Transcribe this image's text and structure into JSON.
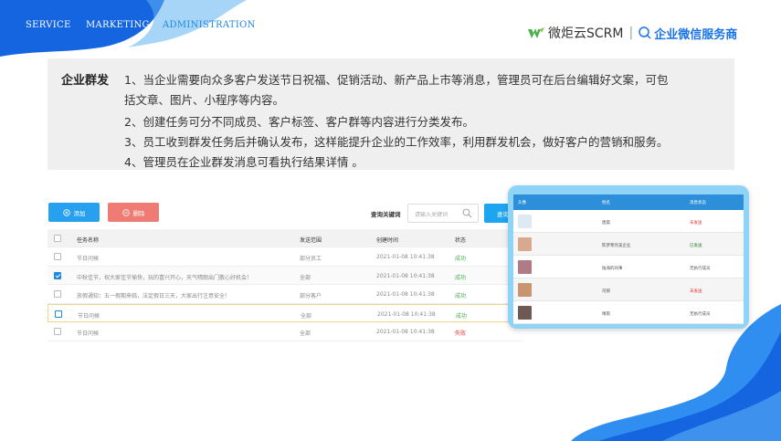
{
  "nav": {
    "items": [
      "SERVICE",
      "MARKETING",
      "ADMINISTRATION"
    ]
  },
  "brand": {
    "product": "微炬云SCRM",
    "separator": "|",
    "tagline": "企业微信服务商",
    "color": "#1a73e8"
  },
  "intro": {
    "title": "企业群发",
    "lines": [
      "1、当企业需要向众多客户发送节日祝福、促销活动、新产品上市等消息，管理员可在后台编辑好文案，可包",
      "括文章、图片、小程序等内容。",
      "2、创建任务可分不同成员、客户标签、客户群等内容进行分类发布。",
      "3、员工收到群发任务后并确认发布，这样能提升企业的工作效率，利用群发机会，做好客户的营销和服务。",
      "4、管理员在企业群发消息可看执行结果详情 。"
    ]
  },
  "toolbar": {
    "add_label": "添加",
    "delete_label": "删除",
    "query_label": "查询关键词",
    "search_placeholder": "请输入关键词",
    "query_button": "查询"
  },
  "table": {
    "headers": [
      "任务名称",
      "发送范围",
      "创建时间",
      "状态"
    ],
    "rows": [
      {
        "name": "节日问候",
        "scope": "部分员工",
        "time": "2021-01-08 10:41:38",
        "status": "成功",
        "checked": false
      },
      {
        "name": "中秋佳节，祝大家佳节愉快，玩的喜兴开心，天气晴朗出门散心好机会！",
        "scope": "全部",
        "time": "2021-01-08 10:41:38",
        "status": "成功",
        "checked": true
      },
      {
        "name": "放假通知：五一假期来临，法定假日三天，大家出行注意安全！",
        "scope": "部分客户",
        "time": "2021-01-08 10:41:38",
        "status": "成功",
        "checked": false
      },
      {
        "name": "节日问候",
        "scope": "全部",
        "time": "2021-01-08 10:41:38",
        "status": "成功",
        "checked": false
      },
      {
        "name": "节日问候",
        "scope": "全部",
        "time": "2021-01-08 10:41:38",
        "status": "失败",
        "checked": false
      }
    ]
  },
  "result_card": {
    "headers": [
      "头像",
      "姓名",
      "消息状态"
    ],
    "rows": [
      {
        "name": "唐晨",
        "status": "未发送",
        "status_color": "#e53935",
        "avatar_color": "#dfe9f3"
      },
      {
        "name": "陈梦寒凭美企业",
        "status": "已发送",
        "status_color": "#2e7d32",
        "avatar_color": "#d8a98f"
      },
      {
        "name": "陆海的同事",
        "status": "无执行成员",
        "status_color": "#555555",
        "avatar_color": "#b07a86"
      },
      {
        "name": "司那",
        "status": "未发送",
        "status_color": "#e53935",
        "avatar_color": "#c99570"
      },
      {
        "name": "晴雨",
        "status": "无执行成员",
        "status_color": "#555555",
        "avatar_color": "#6e5a52"
      }
    ]
  },
  "colors": {
    "accent_blue": "#1e88e5",
    "wave_blue": "#1565e0",
    "success": "#4caf50",
    "fail": "#e53935"
  }
}
